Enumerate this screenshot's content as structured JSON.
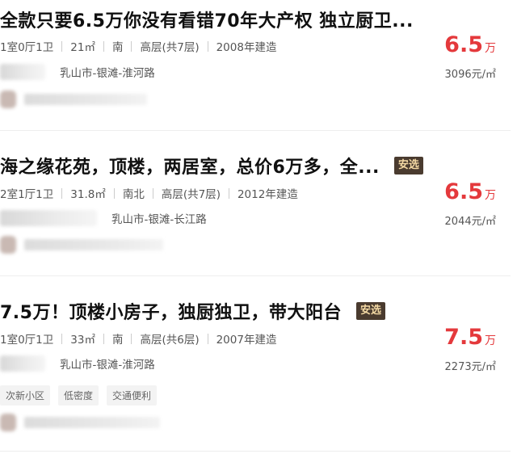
{
  "listings": [
    {
      "title": "全款只要6.5万你没有看错70年大产权 独立厨卫...",
      "badge": "",
      "info": [
        "1室0厅1卫",
        "21㎡",
        "南",
        "高层(共7层)",
        "2008年建造"
      ],
      "address": "乳山市-银滩-淮河路",
      "tags": [],
      "price_total": "6.5",
      "price_unit": "万",
      "price_per": "3096元/㎡"
    },
    {
      "title": "海之缘花苑，顶楼，两居室，总价6万多，全...",
      "badge": "安选",
      "info": [
        "2室1厅1卫",
        "31.8㎡",
        "南北",
        "高层(共7层)",
        "2012年建造"
      ],
      "address": "乳山市-银滩-长江路",
      "tags": [],
      "price_total": "6.5",
      "price_unit": "万",
      "price_per": "2044元/㎡"
    },
    {
      "title": "7.5万！顶楼小房子，独厨独卫，带大阳台",
      "badge": "安选",
      "info": [
        "1室0厅1卫",
        "33㎡",
        "南",
        "高层(共6层)",
        "2007年建造"
      ],
      "address": "乳山市-银滩-淮河路",
      "tags": [
        "次新小区",
        "低密度",
        "交通便利"
      ],
      "price_total": "7.5",
      "price_unit": "万",
      "price_per": "2273元/㎡"
    }
  ]
}
